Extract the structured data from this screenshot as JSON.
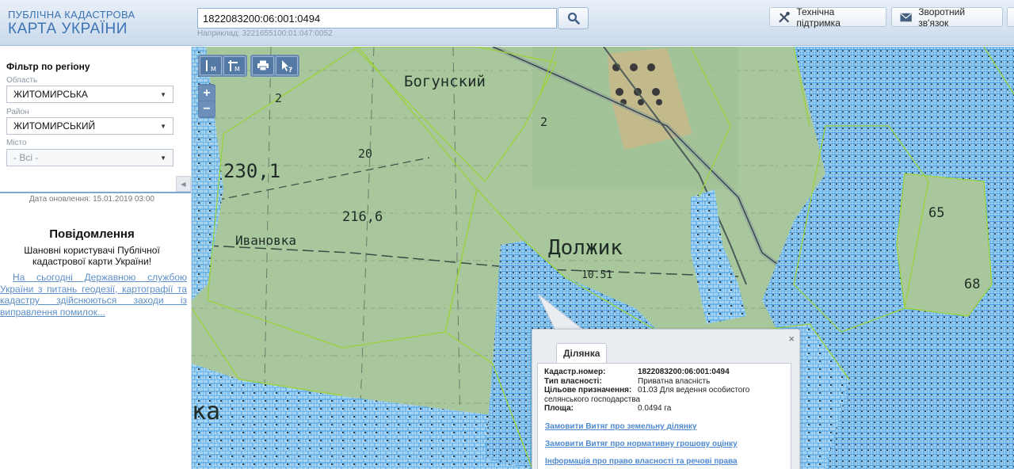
{
  "header": {
    "logo_line1": "ПУБЛІЧНА КАДАСТРОВА",
    "logo_line2": "КАРТА УКРАЇНИ",
    "search_value": "1822083200:06:001:0494",
    "search_example": "Наприклад: 3221655100:01:047:0052",
    "search_icon": "search-icon",
    "support_label": "Технічна підтримка",
    "support_icon": "tools-icon",
    "feedback_label": "Зворотний зв'язок",
    "feedback_icon": "envelope-icon"
  },
  "sidebar": {
    "filter_title": "Фільтр по регіону",
    "region_label": "Область",
    "region_value": "ЖИТОМИРСЬКА",
    "district_label": "Район",
    "district_value": "ЖИТОМИРСЬКИЙ",
    "city_label": "Місто",
    "city_value": "- Всі -",
    "update_date": "Дата оновлення: 15.01.2019 03:00",
    "notice_title": "Повідомлення",
    "notice_text": "Шановні користувачі Публічної кадастрової карти України!",
    "notice_link": "На сьогодні Державною службою України з питань геодезії, картографії та кадастру здійснюються заходи із виправлення помилок..."
  },
  "map": {
    "labels": {
      "bogunsky": "Богунский",
      "dolzhik": "Должик",
      "ivanovka": "Ивановка",
      "ka": "ка",
      "v230": "230,1",
      "v216": "216,6",
      "v20": "20",
      "v2": "2",
      "v65": "65",
      "v68": "68",
      "v1051": "10.51",
      "v2b": "2"
    },
    "colors": {
      "terrain": "#a6c59a",
      "parcel_fill": "#9fd0ee",
      "parcel_stroke": "#4aa3ea",
      "boundary": "#9ad23b"
    }
  },
  "popup": {
    "tab_label": "Ділянка",
    "close_glyph": "×",
    "rows": [
      {
        "key": "Кадастр.номер:",
        "value": "1822083200:06:001:0494"
      },
      {
        "key": "Тип власності:",
        "value": "Приватна власність"
      },
      {
        "key": "Цільове призначення:",
        "value": "01.03 Для ведення особистого"
      },
      {
        "key": "",
        "value": "селянського господарства"
      },
      {
        "key": "Площа:",
        "value": "0.0494 га"
      }
    ],
    "links": [
      "Замовити Витяг про земельну ділянку",
      "Замовити Витяг про нормативну грошову оцінку",
      "Інформація про право власності та речові права"
    ]
  }
}
